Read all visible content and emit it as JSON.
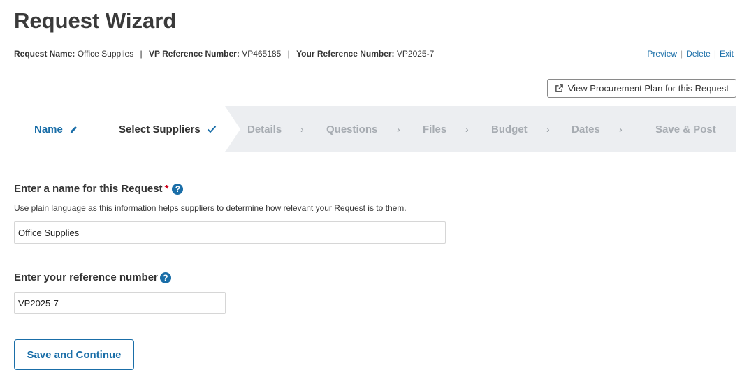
{
  "page": {
    "title": "Request Wizard"
  },
  "meta": {
    "request_name_label": "Request Name:",
    "request_name_value": "Office Supplies",
    "vp_ref_label": "VP Reference Number:",
    "vp_ref_value": "VP465185",
    "your_ref_label": "Your Reference Number:",
    "your_ref_value": "VP2025-7"
  },
  "top_links": {
    "preview": "Preview",
    "delete": "Delete",
    "exit": "Exit"
  },
  "plan_button": {
    "label": "View Procurement Plan for this Request",
    "icon": "external-link-icon"
  },
  "steps": [
    {
      "label": "Name",
      "state": "current-editing",
      "icon": "pencil-icon"
    },
    {
      "label": "Select Suppliers",
      "state": "completed",
      "icon": "checkmark-icon"
    },
    {
      "label": "Details",
      "state": "future"
    },
    {
      "label": "Questions",
      "state": "future"
    },
    {
      "label": "Files",
      "state": "future"
    },
    {
      "label": "Budget",
      "state": "future"
    },
    {
      "label": "Dates",
      "state": "future"
    },
    {
      "label": "Save & Post",
      "state": "future"
    }
  ],
  "step_separator": "›",
  "form": {
    "name_label": "Enter a name for this Request",
    "required_mark": "*",
    "help_glyph": "?",
    "name_hint": "Use plain language as this information helps suppliers to determine how relevant your Request is to them.",
    "name_value": "Office Supplies",
    "ref_label": "Enter your reference number",
    "ref_value": "VP2025-7",
    "submit_label": "Save and Continue"
  },
  "colors": {
    "accent": "#1a6ea8",
    "required": "#d0021b",
    "step_bg": "#eceef1",
    "future_step": "#a7acb2"
  }
}
